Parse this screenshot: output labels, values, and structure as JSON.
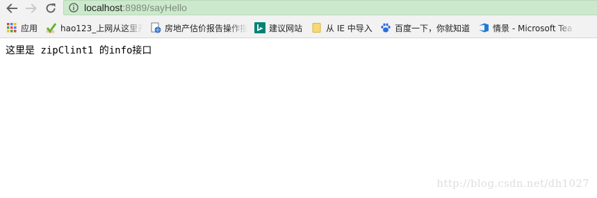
{
  "toolbar": {
    "back_icon": "arrow-left-icon",
    "forward_icon": "arrow-right-icon",
    "reload_icon": "reload-icon",
    "info_icon": "info-circle-icon",
    "url_host": "localhost",
    "url_rest": ":8989/sayHello",
    "omnibox_color": "#cde9cd"
  },
  "bookmarks": [
    {
      "label": "应用",
      "icon": "apps-grid-icon"
    },
    {
      "label": "hao123_上网从这里开",
      "icon": "hao123-icon"
    },
    {
      "label": "房地产估价报告操作指",
      "icon": "page-globe-icon"
    },
    {
      "label": "建议网站",
      "icon": "bing-icon"
    },
    {
      "label": "从 IE 中导入",
      "icon": "folder-icon"
    },
    {
      "label": "百度一下，你就知道",
      "icon": "baidu-paw-icon"
    },
    {
      "label": "情景 - Microsoft Tea",
      "icon": "azure-devops-icon"
    }
  ],
  "page": {
    "message": "这里是 zipClint1 的info接口"
  },
  "watermark": "http://blog.csdn.net/dh1027"
}
